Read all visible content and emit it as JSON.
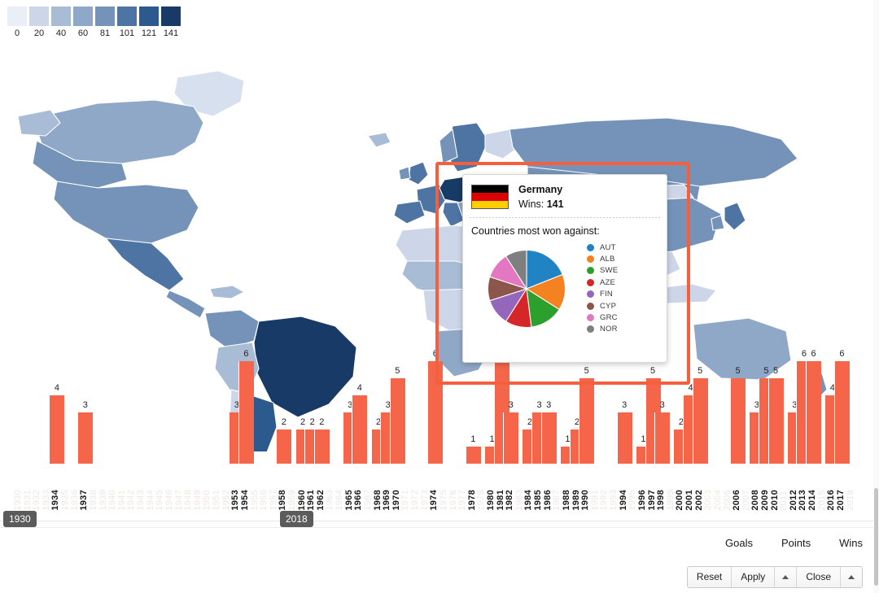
{
  "legend": {
    "name": "wins-color-scale",
    "labels": [
      "0",
      "20",
      "40",
      "60",
      "81",
      "101",
      "121",
      "141"
    ],
    "colors": [
      "#eaeef7",
      "#ccd6e8",
      "#a9bcd6",
      "#90a8c8",
      "#7593b8",
      "#4d74a3",
      "#2c5a8e",
      "#183a66"
    ]
  },
  "map": {
    "name": "world-choropleth",
    "ocean_color": "#ffffff",
    "border_color": "#ffffff",
    "selected_country": "Germany"
  },
  "selection": {
    "label": "map-selection-rectangle",
    "color": "#f4603e"
  },
  "tooltip": {
    "country": "Germany",
    "wins_label": "Wins:",
    "wins_value": "141",
    "subtitle": "Countries most won against:",
    "flag": {
      "name": "germany-flag",
      "bands": [
        "#000000",
        "#dd0000",
        "#ffce00"
      ]
    },
    "pie": {
      "type": "pie",
      "title": "Countries most won against",
      "labels": [
        "AUT",
        "ALB",
        "SWE",
        "AZE",
        "FIN",
        "CYP",
        "GRC",
        "NOR"
      ],
      "values": [
        19,
        15,
        14,
        11,
        11,
        10,
        11,
        9
      ],
      "colors": [
        "#1f83c4",
        "#f58220",
        "#2ca02c",
        "#d62728",
        "#9467bd",
        "#8c564b",
        "#e377c2",
        "#7f7f7f"
      ],
      "legend_position": "right"
    }
  },
  "chart_data": {
    "type": "bar",
    "title": "",
    "xlabel": "",
    "ylabel": "",
    "bar_color": "#f4654a",
    "x_range": [
      1930,
      2018
    ],
    "ylim": [
      0,
      6
    ],
    "grid": false,
    "categories": [
      "1930",
      "1931",
      "1932",
      "1933",
      "1934",
      "1935",
      "1936",
      "1937",
      "1938",
      "1939",
      "1940",
      "1941",
      "1942",
      "1943",
      "1944",
      "1945",
      "1946",
      "1947",
      "1948",
      "1949",
      "1950",
      "1951",
      "1952",
      "1953",
      "1954",
      "1955",
      "1956",
      "1957",
      "1958",
      "1959",
      "1960",
      "1961",
      "1962",
      "1963",
      "1964",
      "1965",
      "1966",
      "1967",
      "1968",
      "1969",
      "1970",
      "1971",
      "1972",
      "1973",
      "1974",
      "1975",
      "1976",
      "1977",
      "1978",
      "1979",
      "1980",
      "1981",
      "1982",
      "1983",
      "1984",
      "1985",
      "1986",
      "1987",
      "1988",
      "1989",
      "1990",
      "1991",
      "1992",
      "1993",
      "1994",
      "1995",
      "1996",
      "1997",
      "1998",
      "1999",
      "2000",
      "2001",
      "2002",
      "2003",
      "2004",
      "2005",
      "2006",
      "2007",
      "2008",
      "2009",
      "2010",
      "2011",
      "2012",
      "2013",
      "2014",
      "2015",
      "2016",
      "2017",
      "2018"
    ],
    "values": [
      0,
      0,
      0,
      0,
      4,
      0,
      0,
      3,
      0,
      0,
      0,
      0,
      0,
      0,
      0,
      0,
      0,
      0,
      0,
      0,
      0,
      0,
      0,
      3,
      6,
      0,
      0,
      0,
      2,
      0,
      2,
      2,
      2,
      0,
      0,
      3,
      4,
      0,
      2,
      3,
      5,
      0,
      0,
      0,
      6,
      0,
      0,
      0,
      1,
      0,
      1,
      6,
      3,
      0,
      2,
      3,
      3,
      0,
      1,
      2,
      5,
      0,
      0,
      0,
      3,
      0,
      1,
      5,
      3,
      0,
      2,
      4,
      5,
      0,
      0,
      0,
      5,
      0,
      3,
      5,
      5,
      0,
      3,
      6,
      6,
      0,
      4,
      6,
      0
    ]
  },
  "slider": {
    "name": "year-range-slider",
    "min_label": "1930",
    "max_label": "2018",
    "track_color": "#7d9fb0",
    "handle_color": "#6fb3c4"
  },
  "bottom": {
    "metric_tabs": [
      {
        "id": "goals",
        "label": "Goals"
      },
      {
        "id": "points",
        "label": "Points"
      },
      {
        "id": "wins",
        "label": "Wins"
      }
    ],
    "actions": [
      {
        "id": "reset",
        "label": "Reset"
      },
      {
        "id": "apply",
        "label": "Apply"
      },
      {
        "id": "apply-caret",
        "label": ""
      },
      {
        "id": "close",
        "label": "Close"
      },
      {
        "id": "close-caret",
        "label": ""
      }
    ]
  }
}
